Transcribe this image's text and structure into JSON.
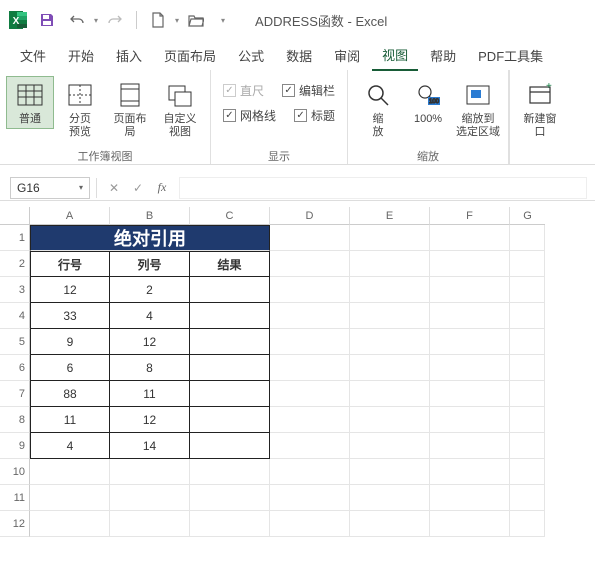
{
  "title": "ADDRESS函数  -  Excel",
  "qat": {
    "save": "保存",
    "undo": "撤销",
    "redo": "恢复",
    "new": "新建",
    "open": "打开"
  },
  "tabs": [
    "文件",
    "开始",
    "插入",
    "页面布局",
    "公式",
    "数据",
    "审阅",
    "视图",
    "帮助",
    "PDF工具集"
  ],
  "active_tab": 7,
  "ribbon": {
    "views": {
      "normal": "普通",
      "pagebreak": "分页\n预览",
      "pagelayout": "页面布局",
      "custom": "自定义视图",
      "label": "工作簿视图"
    },
    "show": {
      "ruler": "直尺",
      "formulabar": "编辑栏",
      "gridlines": "网格线",
      "headings": "标题",
      "label": "显示"
    },
    "zoom": {
      "zoom": "缩\n放",
      "hundred": "100%",
      "selection": "缩放到\n选定区域",
      "label": "缩放"
    },
    "window": {
      "newwin": "新建窗口"
    }
  },
  "namebox": "G16",
  "fx": "fx",
  "columns": [
    "A",
    "B",
    "C",
    "D",
    "E",
    "F",
    "G"
  ],
  "rows": [
    "1",
    "2",
    "3",
    "4",
    "5",
    "6",
    "7",
    "8",
    "9",
    "10",
    "11",
    "12"
  ],
  "table": {
    "title": "绝对引用",
    "headers": [
      "行号",
      "列号",
      "结果"
    ],
    "data": [
      [
        "12",
        "2",
        ""
      ],
      [
        "33",
        "4",
        ""
      ],
      [
        "9",
        "12",
        ""
      ],
      [
        "6",
        "8",
        ""
      ],
      [
        "88",
        "11",
        ""
      ],
      [
        "11",
        "12",
        ""
      ],
      [
        "4",
        "14",
        ""
      ]
    ]
  }
}
